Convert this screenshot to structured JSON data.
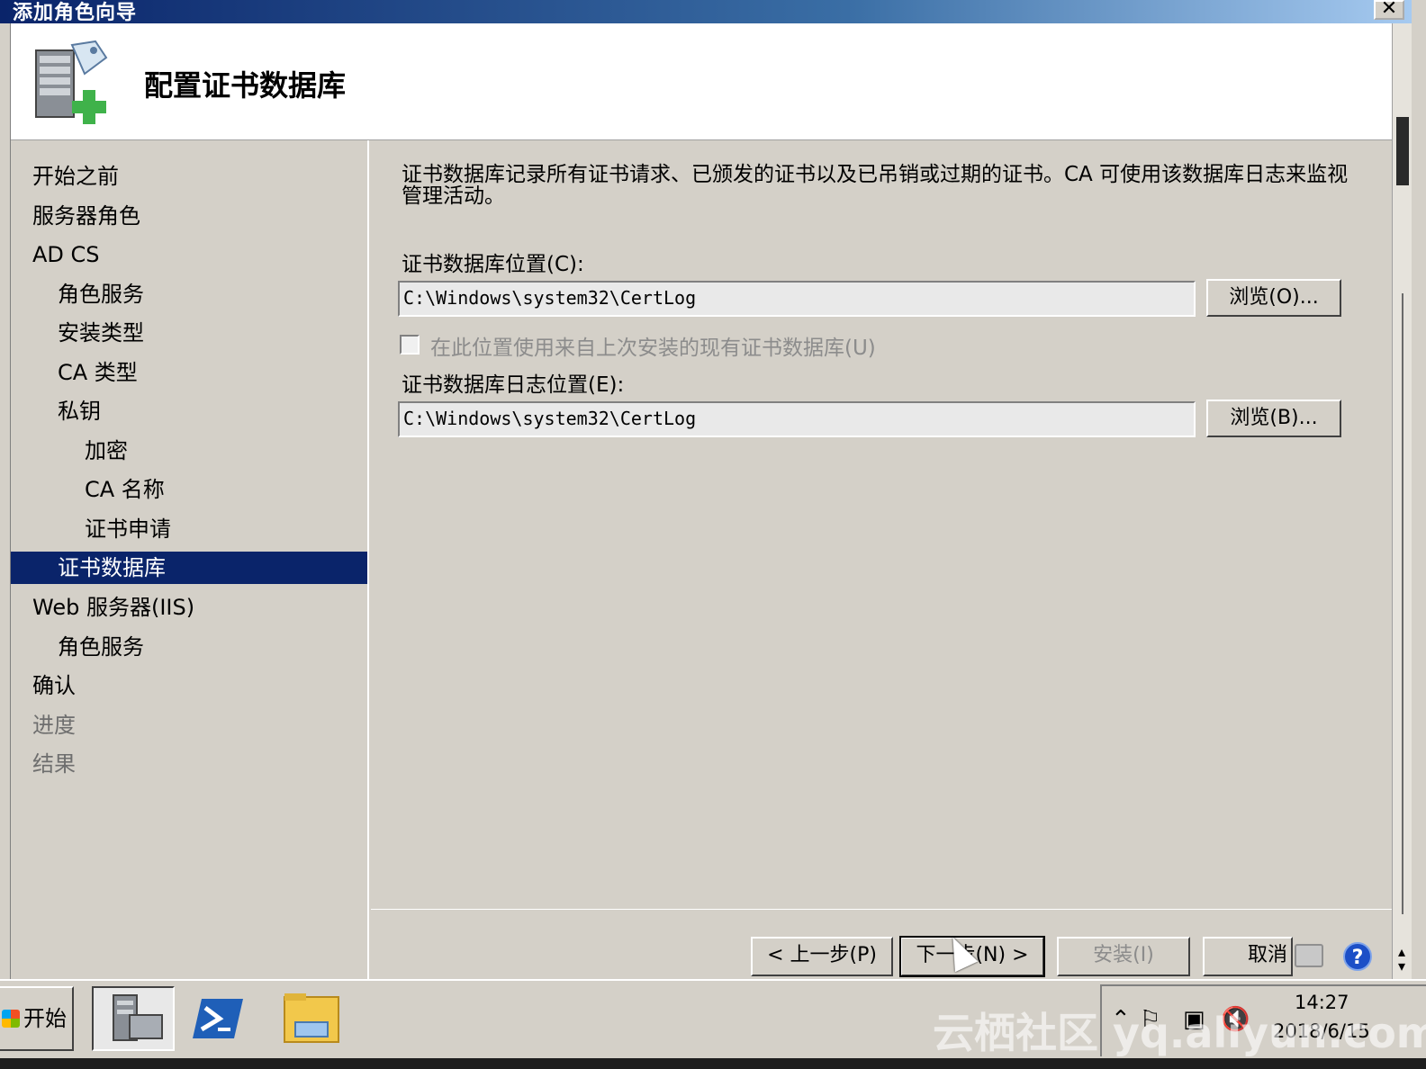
{
  "window": {
    "title": "添加角色向导",
    "close_glyph": "✕"
  },
  "header": {
    "title": "配置证书数据库",
    "icon": "server-add-icon"
  },
  "sidebar": {
    "items": [
      {
        "label": "开始之前",
        "level": 0,
        "state": "normal"
      },
      {
        "label": "服务器角色",
        "level": 0,
        "state": "normal"
      },
      {
        "label": "AD CS",
        "level": 0,
        "state": "normal"
      },
      {
        "label": "角色服务",
        "level": 1,
        "state": "normal"
      },
      {
        "label": "安装类型",
        "level": 1,
        "state": "normal"
      },
      {
        "label": "CA 类型",
        "level": 1,
        "state": "normal"
      },
      {
        "label": "私钥",
        "level": 1,
        "state": "normal"
      },
      {
        "label": "加密",
        "level": 2,
        "state": "normal"
      },
      {
        "label": "CA 名称",
        "level": 2,
        "state": "normal"
      },
      {
        "label": "证书申请",
        "level": 2,
        "state": "normal"
      },
      {
        "label": "证书数据库",
        "level": 1,
        "state": "selected"
      },
      {
        "label": "Web 服务器(IIS)",
        "level": 0,
        "state": "normal"
      },
      {
        "label": "角色服务",
        "level": 1,
        "state": "normal"
      },
      {
        "label": "确认",
        "level": 0,
        "state": "normal"
      },
      {
        "label": "进度",
        "level": 0,
        "state": "disabled"
      },
      {
        "label": "结果",
        "level": 0,
        "state": "disabled"
      }
    ]
  },
  "main": {
    "description": "证书数据库记录所有证书请求、已颁发的证书以及已吊销或过期的证书。CA 可使用该数据库日志来监视管理活动。",
    "db_location": {
      "label": "证书数据库位置(C):",
      "value": "C:\\Windows\\system32\\CertLog",
      "browse_label": "浏览(O)..."
    },
    "reuse_checkbox": {
      "label": "在此位置使用来自上次安装的现有证书数据库(U)",
      "checked": false,
      "enabled": false
    },
    "log_location": {
      "label": "证书数据库日志位置(E):",
      "value": "C:\\Windows\\system32\\CertLog",
      "browse_label": "浏览(B)..."
    }
  },
  "footer": {
    "prev_label": "< 上一步(P)",
    "next_label": "下一步(N) >",
    "install_label": "安装(I)",
    "cancel_label": "取消",
    "help_glyph": "?"
  },
  "taskbar": {
    "start_label": "开始",
    "buttons": [
      "server-manager-icon",
      "powershell-icon",
      "file-explorer-icon"
    ],
    "time": "14:27",
    "date": "2018/6/15",
    "watermark": "云栖社区 yq.aliyun.com"
  }
}
